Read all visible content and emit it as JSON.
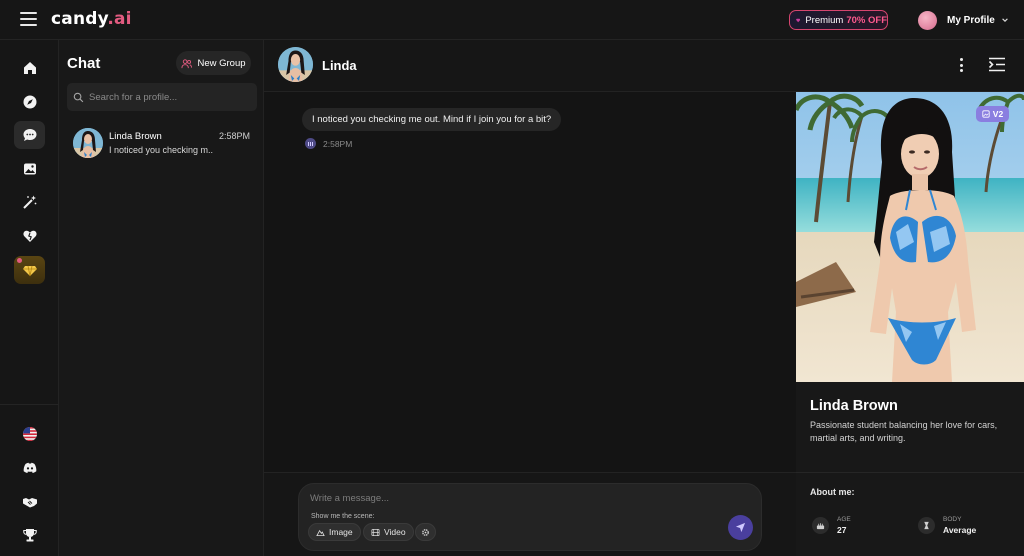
{
  "app": {
    "logo_main": "candy",
    "logo_dot": ".",
    "logo_suffix": "ai"
  },
  "header": {
    "premium_label": "Premium",
    "premium_discount": "70% OFF",
    "profile_label": "My Profile"
  },
  "rail": {
    "icons": [
      "home-icon",
      "compass-icon",
      "chat-icon",
      "gallery-icon",
      "magic-wand-icon",
      "heart-icon",
      "diamond-icon",
      "us-flag-icon",
      "discord-icon",
      "handshake-icon",
      "trophy-icon"
    ]
  },
  "chatlist": {
    "title": "Chat",
    "new_group_label": "New Group",
    "search_placeholder": "Search for a profile...",
    "items": [
      {
        "name": "Linda Brown",
        "time": "2:58PM",
        "preview": "I noticed you checking m..."
      }
    ]
  },
  "conversation": {
    "name": "Linda",
    "messages": [
      {
        "text": "I noticed you checking me out. Mind if I join you for a bit?",
        "time": "2:58PM"
      }
    ],
    "composer_placeholder": "Write a message...",
    "scene_label": "Show me the scene:",
    "chips": [
      "Image",
      "Video"
    ]
  },
  "profile": {
    "badge": "V2",
    "name": "Linda Brown",
    "description": "Passionate student balancing her love for cars, martial arts, and writing.",
    "about_title": "About me:",
    "stats": [
      {
        "label": "AGE",
        "value": "27"
      },
      {
        "label": "BODY",
        "value": "Average"
      }
    ]
  },
  "colors": {
    "accent": "#e25b80",
    "send": "#4a3f9e",
    "badge": "#8a7ee0"
  }
}
